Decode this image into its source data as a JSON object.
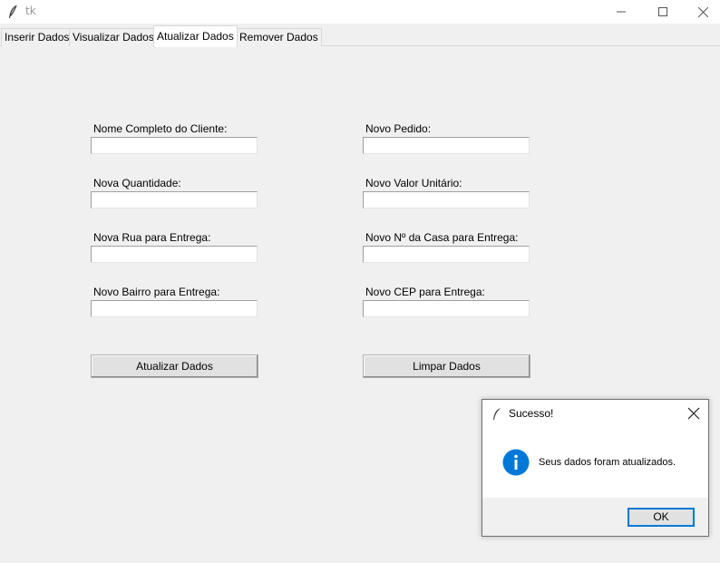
{
  "window": {
    "title": "tk",
    "icon": "feather-icon",
    "controls": [
      "minimize-icon",
      "maximize-icon",
      "close-icon"
    ]
  },
  "tabs": [
    {
      "label": "Inserir Dados",
      "active": false
    },
    {
      "label": "Visualizar Dados",
      "active": false
    },
    {
      "label": "Atualizar Dados",
      "active": true
    },
    {
      "label": "Remover Dados",
      "active": false
    }
  ],
  "form": {
    "fields": [
      {
        "label": "Nome Completo do Cliente:",
        "value": ""
      },
      {
        "label": "Novo Pedido:",
        "value": ""
      },
      {
        "label": "Nova Quantidade:",
        "value": ""
      },
      {
        "label": "Novo Valor Unitário:",
        "value": ""
      },
      {
        "label": "Nova Rua para Entrega:",
        "value": ""
      },
      {
        "label": "Novo Nº da Casa para Entrega:",
        "value": ""
      },
      {
        "label": "Novo Bairro para Entrega:",
        "value": ""
      },
      {
        "label": "Novo CEP para Entrega:",
        "value": ""
      }
    ],
    "update_button": "Atualizar Dados",
    "clear_button": "Limpar Dados"
  },
  "dialog": {
    "title": "Sucesso!",
    "message": "Seus dados foram atualizados.",
    "ok_label": "OK",
    "icon": "info-icon",
    "accent_color": "#0078d7"
  },
  "colors": {
    "background": "#f0f0f0",
    "titlebar": "#ffffff",
    "info_icon": "#0078d7"
  }
}
